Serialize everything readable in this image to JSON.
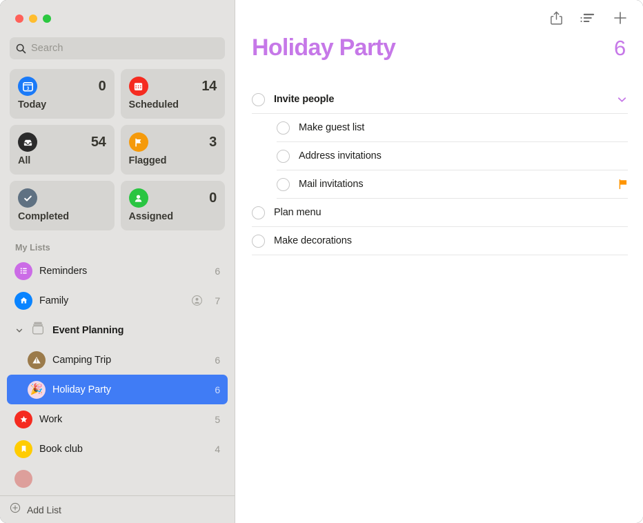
{
  "window": {
    "traffic_lights": [
      "close",
      "minimize",
      "zoom"
    ],
    "colors": {
      "accent_purple": "#c678e8",
      "selection_blue": "#407cf5",
      "flag_orange": "#ff9500",
      "sidebar_bg": "#e4e3e1"
    }
  },
  "sidebar": {
    "search": {
      "placeholder": "Search",
      "value": ""
    },
    "smart_lists": [
      {
        "label": "Today",
        "count": "0",
        "icon": "calendar-day-icon",
        "color": "#1a7af8"
      },
      {
        "label": "Scheduled",
        "count": "14",
        "icon": "calendar-icon",
        "color": "#f52b20"
      },
      {
        "label": "All",
        "count": "54",
        "icon": "inbox-tray-icon",
        "color": "#2b2b2b"
      },
      {
        "label": "Flagged",
        "count": "3",
        "icon": "flag-icon",
        "color": "#f59a0b"
      },
      {
        "label": "Completed",
        "count": "",
        "icon": "checkmark-icon",
        "color": "#5f7182"
      },
      {
        "label": "Assigned",
        "count": "0",
        "icon": "person-icon",
        "color": "#29c541"
      }
    ],
    "my_lists_header": "My Lists",
    "lists": [
      {
        "label": "Reminders",
        "count": "6",
        "icon": "bulleted-list-icon",
        "color": "#cb6ce6",
        "indent": false,
        "selected": false,
        "shared": false
      },
      {
        "label": "Family",
        "count": "7",
        "icon": "house-icon",
        "color": "#0a84ff",
        "indent": false,
        "selected": false,
        "shared": true
      }
    ],
    "group": {
      "label": "Event Planning",
      "icon": "folder-stack-icon",
      "expanded": true,
      "items": [
        {
          "label": "Camping Trip",
          "count": "6",
          "icon": "tent-icon",
          "color": "#9b7b4b",
          "selected": false,
          "shared": false
        },
        {
          "label": "Holiday Party",
          "count": "6",
          "icon": "party-popper-icon",
          "color": "#f2d6e6",
          "selected": true,
          "shared": false
        }
      ]
    },
    "lists_after": [
      {
        "label": "Work",
        "count": "5",
        "icon": "star-icon",
        "color": "#f52b20",
        "indent": false,
        "selected": false,
        "shared": false
      },
      {
        "label": "Book club",
        "count": "4",
        "icon": "bookmark-icon",
        "color": "#ffcc00",
        "indent": false,
        "selected": false,
        "shared": false
      }
    ],
    "partial_list": {
      "label": "",
      "count": "",
      "icon": "partial-list-icon",
      "color": "#dd9f9b"
    },
    "footer": {
      "label": "Add List",
      "icon": "plus-circle-icon"
    }
  },
  "main": {
    "toolbar": [
      {
        "name": "share-icon",
        "label": "Share"
      },
      {
        "name": "list-sort-icon",
        "label": "List Options"
      },
      {
        "name": "plus-icon",
        "label": "Add Reminder"
      }
    ],
    "title": "Holiday Party",
    "count": "6",
    "reminders": [
      {
        "title": "Invite people",
        "sub": false,
        "parent": true,
        "accessory": "chevron-down-icon"
      },
      {
        "title": "Make guest list",
        "sub": true,
        "parent": false,
        "accessory": ""
      },
      {
        "title": "Address invitations",
        "sub": true,
        "parent": false,
        "accessory": ""
      },
      {
        "title": "Mail invitations",
        "sub": true,
        "parent": false,
        "accessory": "flag-icon"
      },
      {
        "title": "Plan menu",
        "sub": false,
        "parent": false,
        "accessory": ""
      },
      {
        "title": "Make decorations",
        "sub": false,
        "parent": false,
        "accessory": ""
      }
    ]
  }
}
